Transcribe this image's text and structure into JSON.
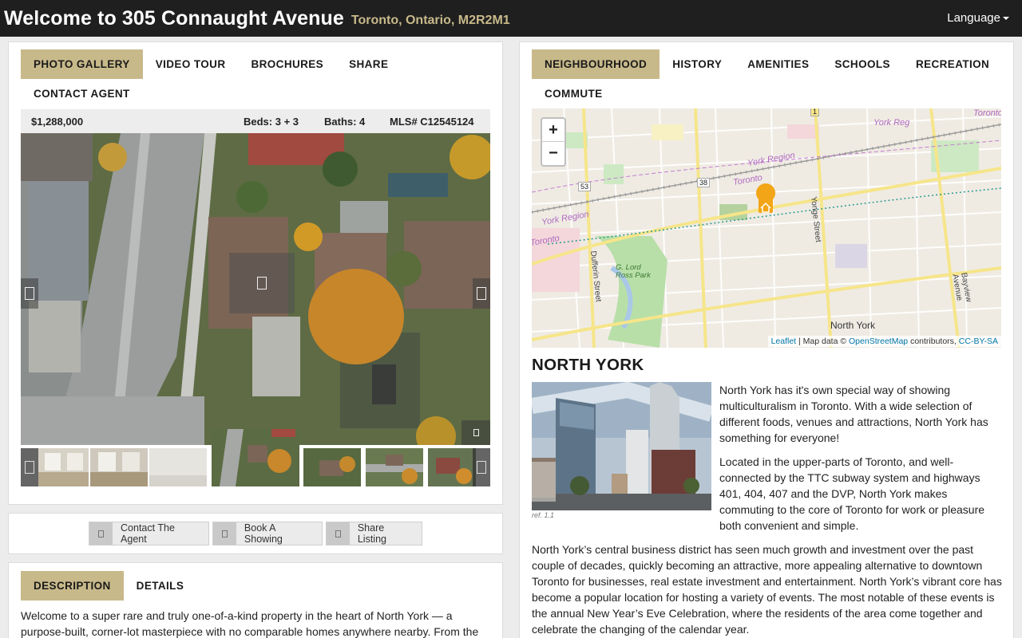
{
  "header": {
    "title": "Welcome to 305 Connaught Avenue",
    "location": "Toronto, Ontario, M2R2M1",
    "language": "Language"
  },
  "left_tabs": [
    "PHOTO GALLERY",
    "VIDEO TOUR",
    "BROCHURES",
    "SHARE",
    "CONTACT AGENT"
  ],
  "listing": {
    "price": "$1,288,000",
    "beds": "Beds: 3 + 3",
    "baths": "Baths: 4",
    "mls": "MLS# C12545124"
  },
  "actions": {
    "contact": "Contact The Agent",
    "book": "Book A Showing",
    "share": "Share Listing"
  },
  "desc_tabs": [
    "DESCRIPTION",
    "DETAILS"
  ],
  "description": "Welcome to a super rare and truly one-of-a-kind property in the heart of North York — a purpose-built, corner-lot masterpiece with no comparable homes anywhere nearby. From the",
  "right_tabs": [
    "NEIGHBOURHOOD",
    "HISTORY",
    "AMENITIES",
    "SCHOOLS",
    "RECREATION",
    "COMMUTE"
  ],
  "map": {
    "zoom_in": "+",
    "zoom_out": "−",
    "labels": {
      "york_region_1": "York Region",
      "york_region_2": "York Region",
      "york_region_3": "York Region",
      "toronto_1": "Toronto",
      "toronto_2": "Toronto",
      "toronto_3": "Toronto",
      "york_region_4": "York Reg",
      "north_york": "North York",
      "yonge": "Yonge Street",
      "dufferin": "Dufferin Street",
      "bayview": "Bayview Avenue",
      "park": "G. Lord Ross Park",
      "route_53": "53",
      "route_38": "38",
      "route_1": "1"
    },
    "attribution": {
      "leaflet": "Leaflet",
      "data": " | Map data © ",
      "osm": "OpenStreetMap",
      "contributors": " contributors, ",
      "license": "CC-BY-SA"
    }
  },
  "neighbourhood": {
    "title": "NORTH YORK",
    "ref": "ref. 1.1",
    "para1": "North York has it's own special way of showing multiculturalism in Toronto. With a wide selection of different foods, venues and attractions, North York has something for everyone!",
    "para2": "Located in the upper-parts of Toronto, and well-connected by the TTC subway system and highways 401, 404, 407 and the DVP, North York makes commuting to the core of Toronto for work or pleasure both convenient and simple.",
    "para3": "North York’s central business district has seen much growth and investment over the past couple of decades, quickly becoming an attractive, more appealing alternative to downtown Toronto for businesses, real estate investment and entertainment. North York’s vibrant core has become a popular location for hosting a variety of events. The most notable of these events is the annual New Year’s Eve Celebration, where the residents of the area come together and celebrate the changing of the calendar year."
  },
  "colors": {
    "accent": "#c8b98a",
    "header_bg": "#1f1f1f",
    "link": "#0078a8"
  }
}
